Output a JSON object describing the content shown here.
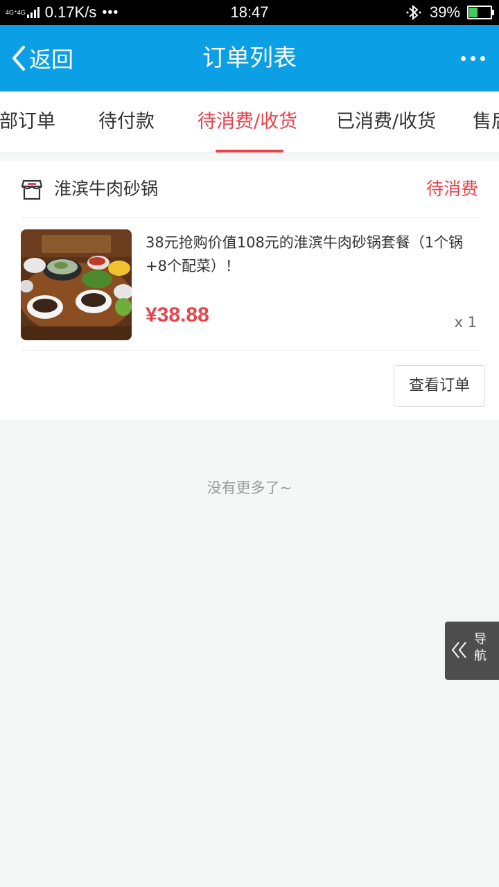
{
  "status_bar": {
    "network_type": "4G⁺4G",
    "net_speed": "0.17K/s",
    "overflow": "•••",
    "time": "18:47",
    "battery_percent": "39%",
    "battery_level": 0.39
  },
  "titlebar": {
    "back_label": "返回",
    "title": "订单列表"
  },
  "tabs": [
    {
      "label": "全部订单",
      "active": false
    },
    {
      "label": "待付款",
      "active": false
    },
    {
      "label": "待消费/收货",
      "active": true
    },
    {
      "label": "已消费/收货",
      "active": false
    },
    {
      "label": "售后",
      "active": false
    }
  ],
  "order": {
    "shop_name": "淮滨牛肉砂锅",
    "status": "待消费",
    "product_title": "38元抢购价值108元的淮滨牛肉砂锅套餐（1个锅+8个配菜）！",
    "price": "¥38.88",
    "quantity": "x 1",
    "view_button": "查看订单"
  },
  "list_footer": "没有更多了~",
  "nav_float": {
    "label": "导航"
  },
  "colors": {
    "brand_blue": "#0ba0e6",
    "accent_red": "#e8434b",
    "background": "#f5f6f6"
  }
}
